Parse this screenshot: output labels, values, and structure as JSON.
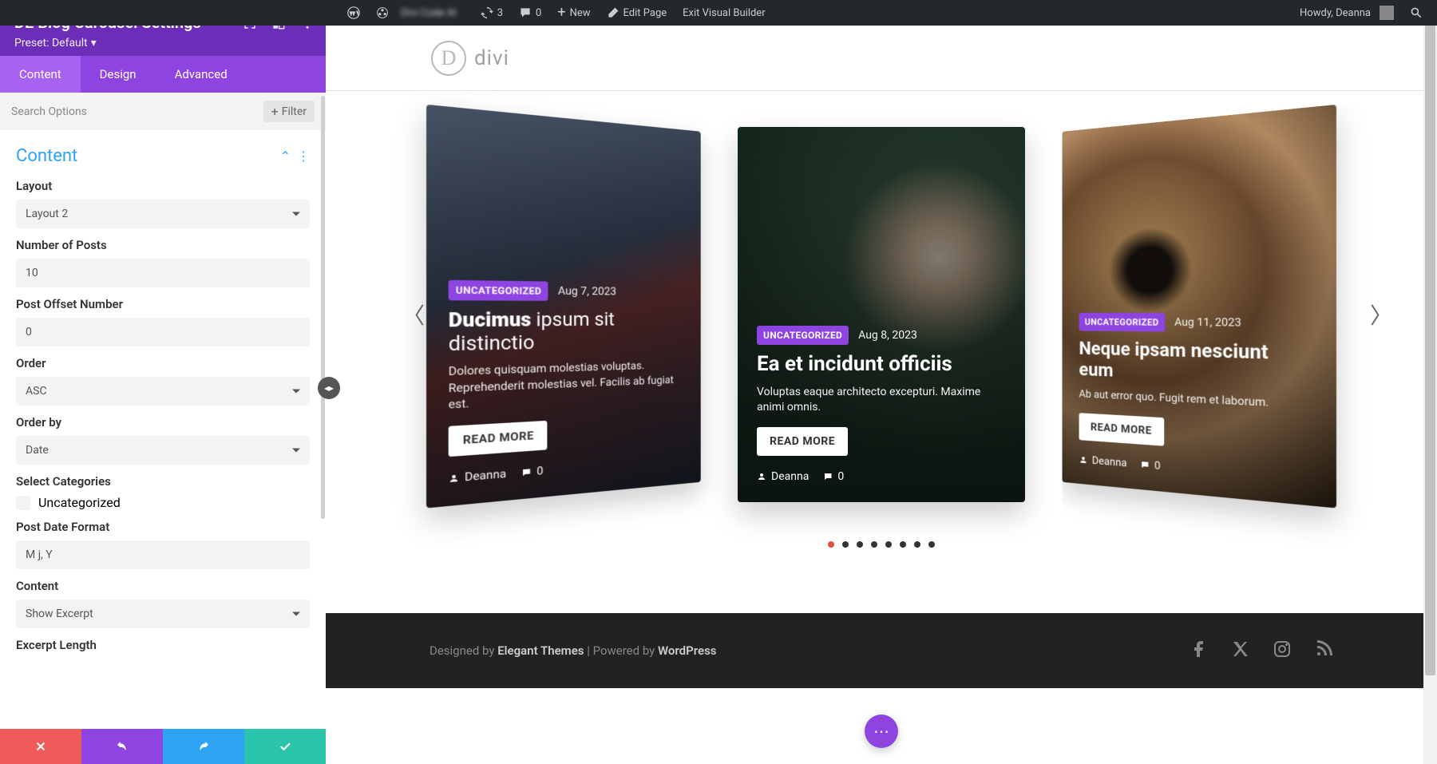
{
  "adminbar": {
    "refresh_count": "3",
    "comments_count": "0",
    "new_label": "New",
    "edit_page_label": "Edit Page",
    "exit_vb_label": "Exit Visual Builder",
    "howdy": "Howdy, Deanna"
  },
  "panel": {
    "title": "DE Blog Carousel Settings",
    "preset": "Preset: Default",
    "tabs": {
      "content": "Content",
      "design": "Design",
      "advanced": "Advanced"
    },
    "search_placeholder": "Search Options",
    "filter_label": "Filter",
    "section_title": "Content",
    "fields": {
      "layout": {
        "label": "Layout",
        "value": "Layout 2"
      },
      "num_posts": {
        "label": "Number of Posts",
        "value": "10"
      },
      "offset": {
        "label": "Post Offset Number",
        "value": "0"
      },
      "order": {
        "label": "Order",
        "value": "ASC"
      },
      "orderby": {
        "label": "Order by",
        "value": "Date"
      },
      "categories": {
        "label": "Select Categories",
        "option": "Uncategorized"
      },
      "date_format": {
        "label": "Post Date Format",
        "value": "M j, Y"
      },
      "content": {
        "label": "Content",
        "value": "Show Excerpt"
      },
      "excerpt_len": {
        "label": "Excerpt Length"
      }
    }
  },
  "site": {
    "logo_text": "divi",
    "footer_designed": "Designed by ",
    "footer_theme": "Elegant Themes",
    "footer_sep": " | Powered by ",
    "footer_wp": "WordPress"
  },
  "carousel": {
    "readmore": "READ MORE",
    "cards": [
      {
        "badge": "UNCATEGORIZED",
        "date": "Aug 7, 2023",
        "title_strong": "Ducimus ",
        "title_rest": "ipsum sit distinctio",
        "excerpt": "Dolores quisquam molestias voluptas. Reprehenderit molestias vel. Facilis ab fugiat est.",
        "author": "Deanna",
        "comments": "0"
      },
      {
        "badge": "UNCATEGORIZED",
        "date": "Aug 8, 2023",
        "title": "Ea et incidunt officiis",
        "excerpt": "Voluptas eaque architecto excepturi. Maxime animi omnis.",
        "author": "Deanna",
        "comments": "0"
      },
      {
        "badge": "UNCATEGORIZED",
        "date": "Aug 11, 2023",
        "title": "Neque ipsam nesciunt eum",
        "excerpt": "Ab aut error quo. Fugit rem et laborum.",
        "author": "Deanna",
        "comments": "0"
      }
    ],
    "dot_count": 8,
    "active_dot": 0
  }
}
